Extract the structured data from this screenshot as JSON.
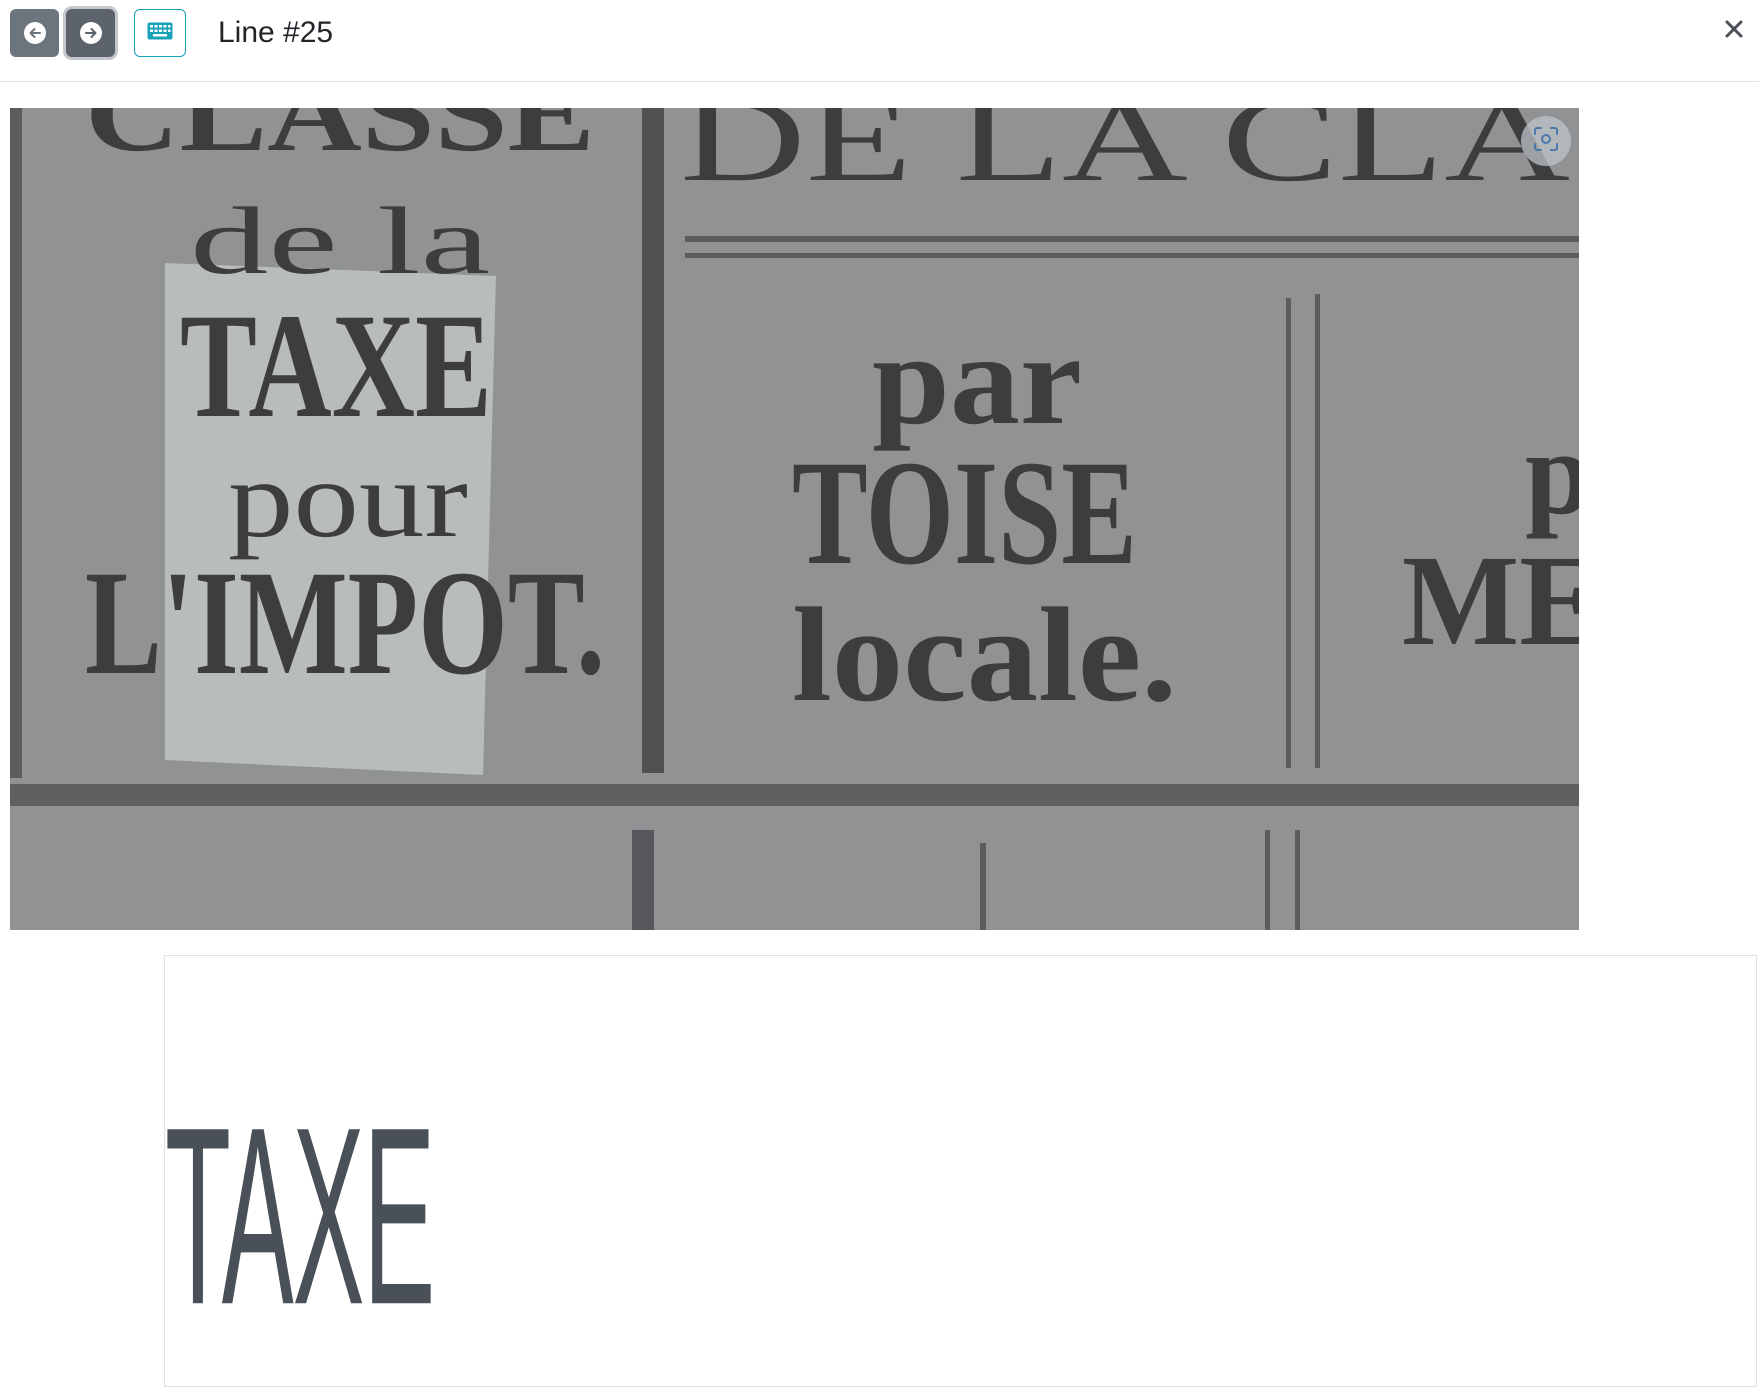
{
  "header": {
    "title": "Line #25",
    "prev_icon": "arrow-left-circle-icon",
    "next_icon": "arrow-right-circle-icon",
    "keyboard_icon": "keyboard-icon",
    "close_icon": "close-icon"
  },
  "scan": {
    "focus_icon": "focus-icon",
    "top_left_text": "CLASSE",
    "top_right_text": "DE LA CLA",
    "left_lines": [
      "de la",
      "TAXE",
      "pour",
      "L'IMPOT."
    ],
    "middle_lines": [
      "par",
      "TOISE",
      "locale."
    ],
    "right_lines": [
      "p",
      "ME"
    ]
  },
  "transcription": {
    "text": "TAXE"
  },
  "colors": {
    "nav_button": "#6c757d",
    "keyboard_border": "#17a2b8",
    "transcription_text": "#495057"
  }
}
